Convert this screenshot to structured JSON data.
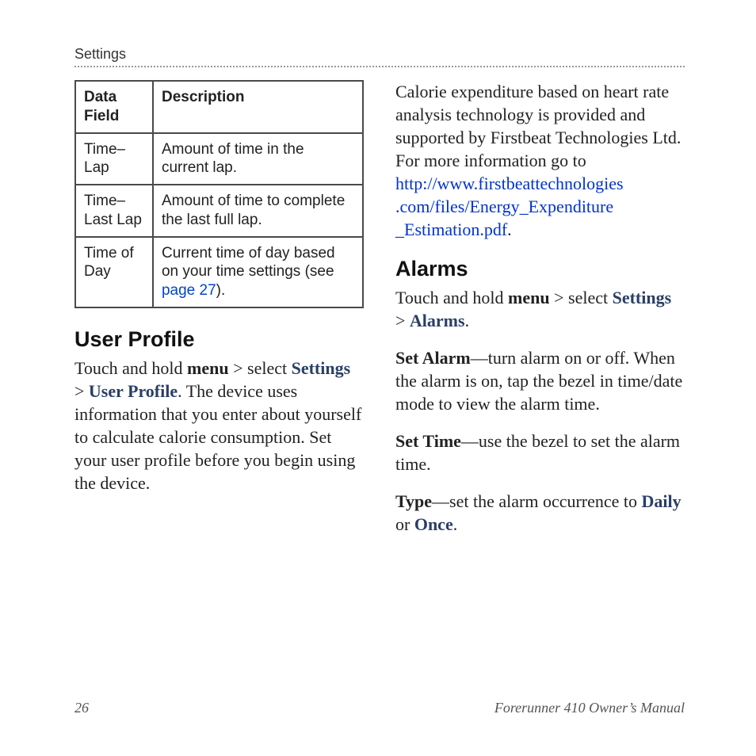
{
  "header": "Settings",
  "table": {
    "headers": [
      "Data Field",
      "Description"
    ],
    "rows": [
      {
        "field": "Time–Lap",
        "desc": "Amount of time in the current lap."
      },
      {
        "field": "Time–Last Lap",
        "desc": "Amount of time to complete the last full lap."
      },
      {
        "field": "Time of Day",
        "desc_pre": "Current time of day based on your time settings (see ",
        "page_ref": "page 27",
        "desc_post": ")."
      }
    ]
  },
  "left": {
    "h_user_profile": "User Profile",
    "p1_a": "Touch and hold ",
    "p1_menu": "menu",
    "p1_b": " > select ",
    "p1_settings": "Settings",
    "p1_c": " > ",
    "p1_userprofile": "User Profile",
    "p1_d": ". The device uses information that you enter about yourself to calculate calorie consumption. Set your user profile before you begin using the device."
  },
  "right": {
    "p_cal_a": "Calorie expenditure based on heart rate analysis technology is provided and supported by Firstbeat Technologies Ltd. For more information go to ",
    "link_text": "http://www.firstbeattechnologies\n.com/files/Energy_Expenditure\n_Estimation.pdf",
    "p_cal_b": ".",
    "h_alarms": "Alarms",
    "p2_a": "Touch and hold ",
    "p2_menu": "menu",
    "p2_b": " > select ",
    "p2_settings": "Settings",
    "p2_c": " > ",
    "p2_alarms": "Alarms",
    "p2_d": ".",
    "p3_label": "Set Alarm",
    "p3_body": "—turn alarm on or off. When the alarm is on, tap the bezel in time/date mode to view the alarm time.",
    "p4_label": "Set Time",
    "p4_body": "—use the bezel to set the alarm time.",
    "p5_label": "Type",
    "p5_body_a": "—set the alarm occurrence to ",
    "p5_daily": "Daily",
    "p5_or": " or ",
    "p5_once": "Once",
    "p5_body_b": "."
  },
  "footer": {
    "page": "26",
    "title": "Forerunner 410 Owner’s Manual"
  }
}
